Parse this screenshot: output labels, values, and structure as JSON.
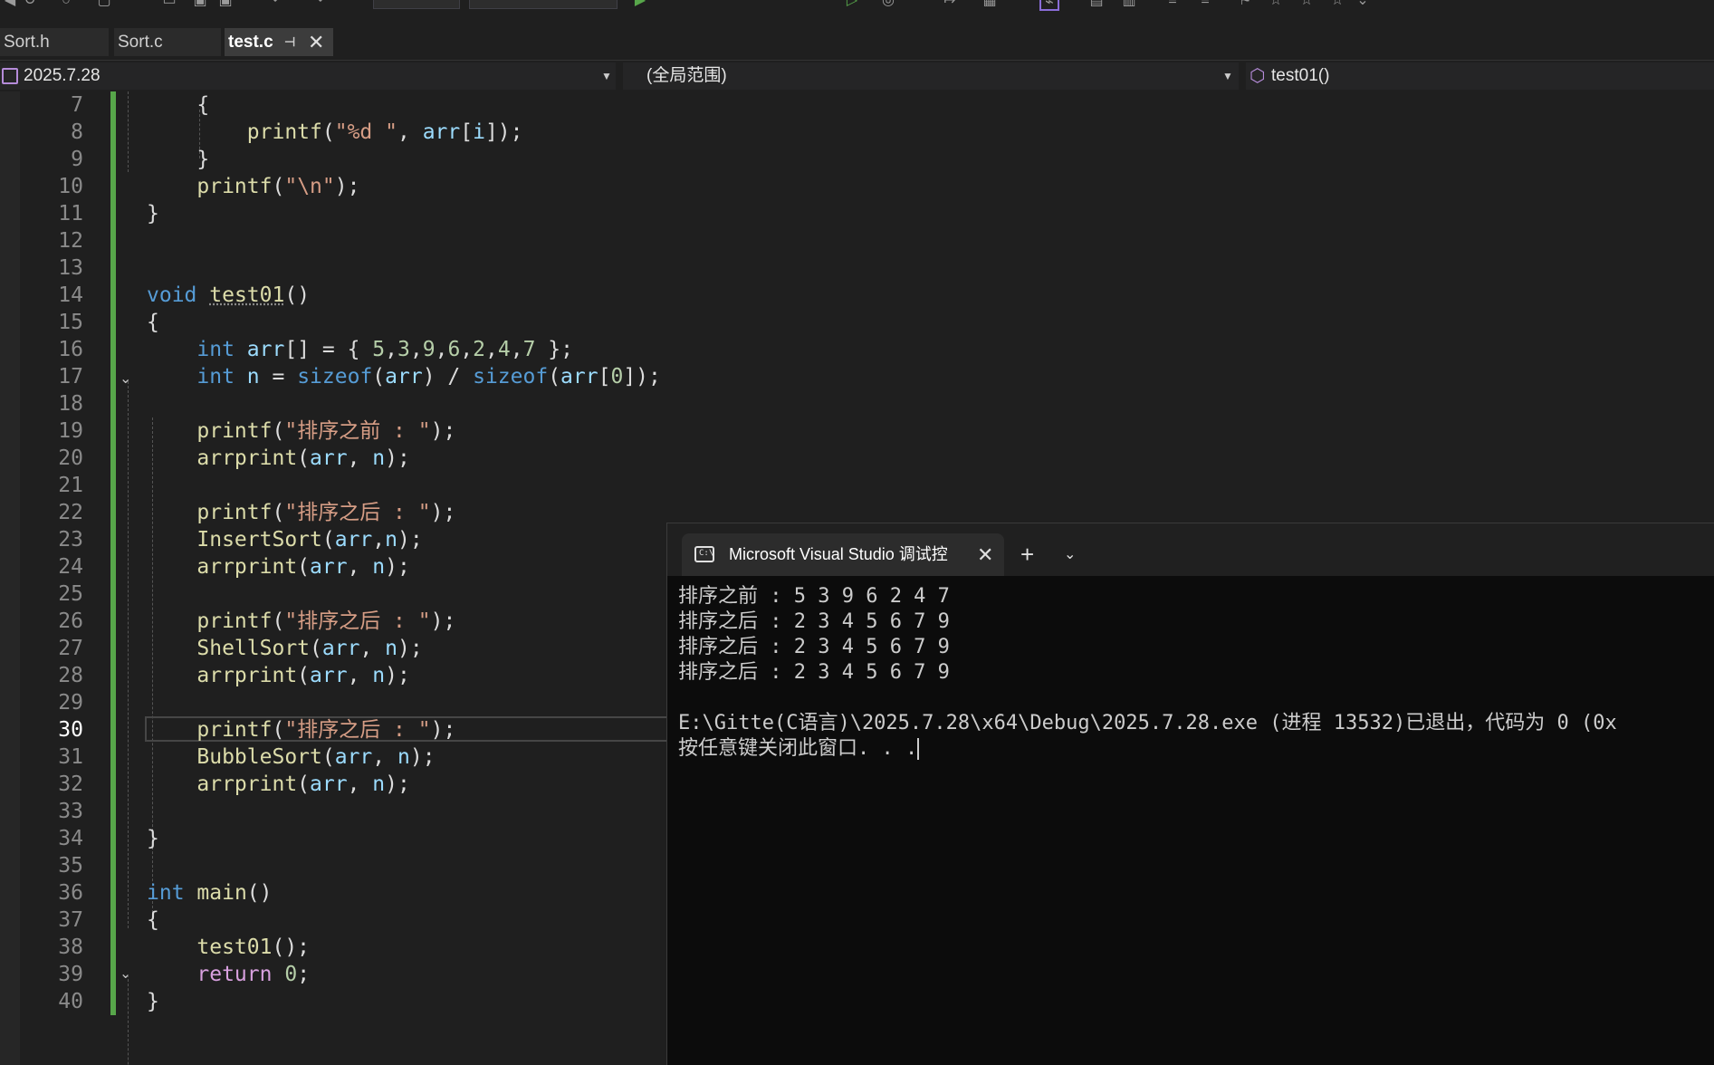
{
  "tabs": [
    {
      "label": "Sort.h",
      "active": false
    },
    {
      "label": "Sort.c",
      "active": false
    },
    {
      "label": "test.c",
      "active": true
    }
  ],
  "navbar": {
    "project": "2025.7.28",
    "scope": "(全局范围)",
    "member": "test01()"
  },
  "editor": {
    "current_line": 30,
    "line_numbers": [
      "7",
      "8",
      "9",
      "10",
      "11",
      "12",
      "13",
      "14",
      "15",
      "16",
      "17",
      "18",
      "19",
      "20",
      "21",
      "22",
      "23",
      "24",
      "25",
      "26",
      "27",
      "28",
      "29",
      "30",
      "31",
      "32",
      "33",
      "34",
      "35",
      "36",
      "37",
      "38",
      "39",
      "40"
    ]
  },
  "console": {
    "title": "Microsoft Visual Studio 调试控",
    "lines": [
      "排序之前 : 5 3 9 6 2 4 7",
      "排序之后 : 2 3 4 5 6 7 9",
      "排序之后 : 2 3 4 5 6 7 9",
      "排序之后 : 2 3 4 5 6 7 9",
      "",
      "E:\\Gitte(C语言)\\2025.7.28\\x64\\Debug\\2025.7.28.exe (进程 13532)已退出，代码为 0 (0x",
      "按任意键关闭此窗口. . ."
    ]
  },
  "colors": {
    "background": "#1f1f1f",
    "keyword": "#569cd6",
    "function": "#dcdcaa",
    "variable": "#9cdcfe",
    "string": "#d69d85",
    "number": "#b5cea8",
    "control_keyword": "#d8a0df",
    "change_bar": "#57a64a"
  }
}
